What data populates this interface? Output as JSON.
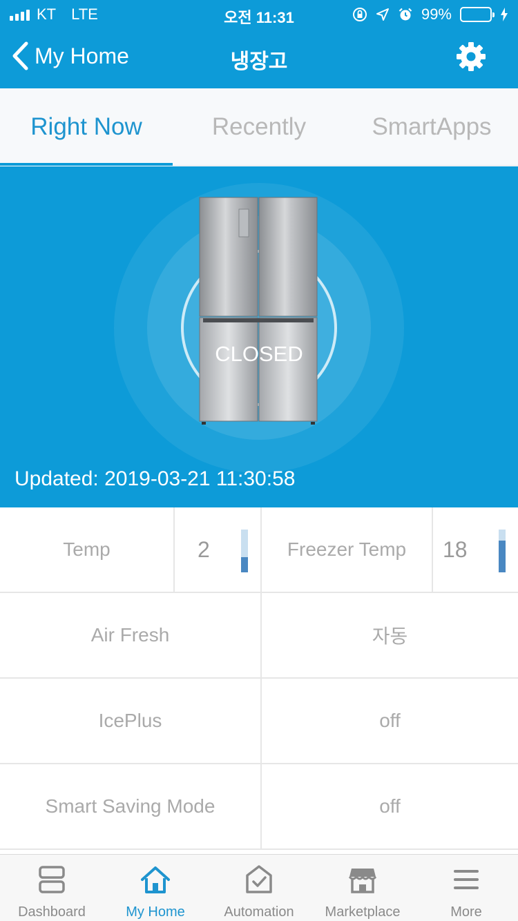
{
  "status_bar": {
    "carrier": "KT",
    "network": "LTE",
    "time": "오전 11:31",
    "battery_percent": "99%",
    "battery_level": 0.99
  },
  "nav": {
    "back_label": "My Home",
    "title": "냉장고"
  },
  "tabs": [
    {
      "label": "Right Now",
      "active": true
    },
    {
      "label": "Recently",
      "active": false
    },
    {
      "label": "SmartApps",
      "active": false
    }
  ],
  "hero": {
    "door_state": "CLOSED",
    "updated": "Updated: 2019-03-21 11:30:58"
  },
  "rows": {
    "temp_label": "Temp",
    "temp_value": "2",
    "temp_level": 0.35,
    "freezer_label": "Freezer Temp",
    "freezer_value": "18",
    "freezer_level": 0.75,
    "air_fresh_label": "Air Fresh",
    "air_fresh_value": "자동",
    "iceplus_label": "IcePlus",
    "iceplus_value": "off",
    "smart_saving_label": "Smart Saving Mode",
    "smart_saving_value": "off"
  },
  "bottom_tabs": [
    {
      "label": "Dashboard",
      "icon": "dashboard-icon",
      "active": false
    },
    {
      "label": "My Home",
      "icon": "home-icon",
      "active": true
    },
    {
      "label": "Automation",
      "icon": "automation-icon",
      "active": false
    },
    {
      "label": "Marketplace",
      "icon": "marketplace-icon",
      "active": false
    },
    {
      "label": "More",
      "icon": "menu-icon",
      "active": false
    }
  ],
  "colors": {
    "primary": "#0d9bd8",
    "active_text": "#1e94cf",
    "level_bar": "#4a88c2"
  }
}
